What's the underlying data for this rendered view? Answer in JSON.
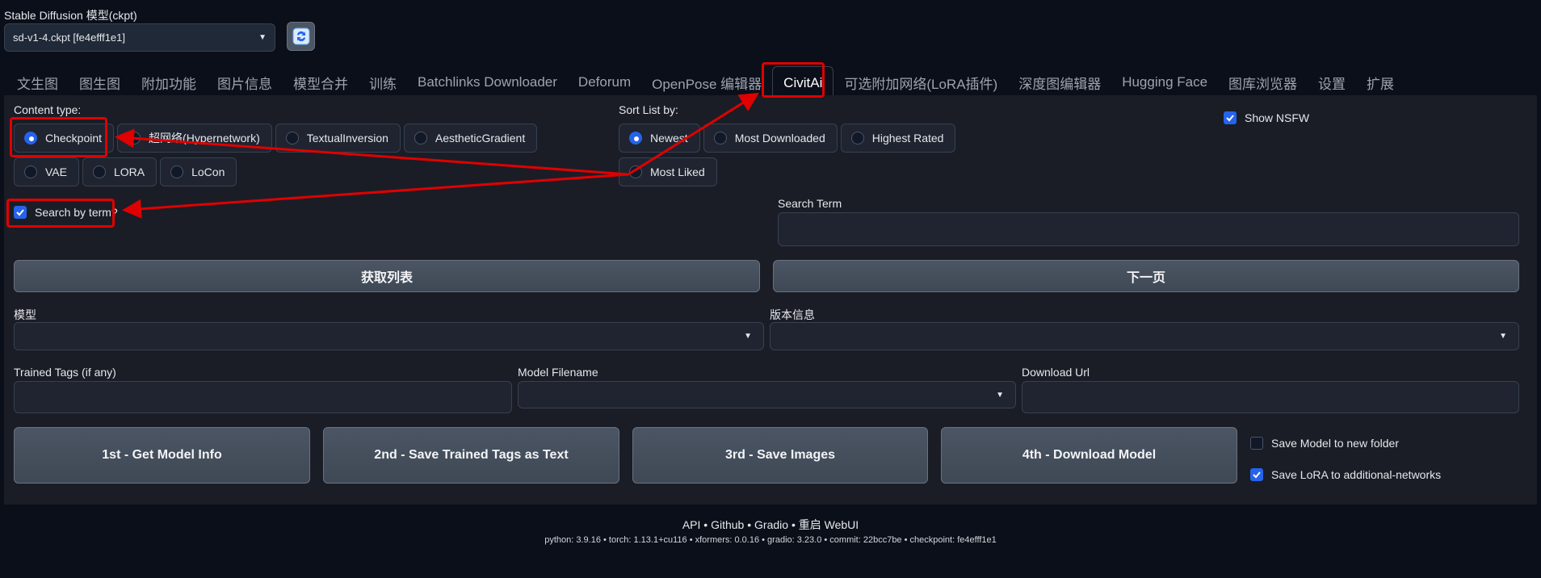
{
  "model": {
    "title": "Stable Diffusion 模型(ckpt)",
    "selected": "sd-v1-4.ckpt [fe4efff1e1]"
  },
  "tabs": [
    {
      "label": "文生图"
    },
    {
      "label": "图生图"
    },
    {
      "label": "附加功能"
    },
    {
      "label": "图片信息"
    },
    {
      "label": "模型合并"
    },
    {
      "label": "训练"
    },
    {
      "label": "Batchlinks Downloader"
    },
    {
      "label": "Deforum"
    },
    {
      "label": "OpenPose 编辑器"
    },
    {
      "label": "CivitAi"
    },
    {
      "label": "可选附加网络(LoRA插件)"
    },
    {
      "label": "深度图编辑器"
    },
    {
      "label": "Hugging Face"
    },
    {
      "label": "图库浏览器"
    },
    {
      "label": "设置"
    },
    {
      "label": "扩展"
    }
  ],
  "content_type": {
    "label": "Content type:",
    "options": [
      "Checkpoint",
      "超网络(Hypernetwork)",
      "TextualInversion",
      "AestheticGradient",
      "VAE",
      "LORA",
      "LoCon"
    ],
    "selected": "Checkpoint"
  },
  "sort": {
    "label": "Sort List by:",
    "options": [
      "Newest",
      "Most Downloaded",
      "Highest Rated",
      "Most Liked"
    ],
    "selected": "Newest"
  },
  "show_nsfw": {
    "label": "Show NSFW",
    "checked": true
  },
  "search_by_term": {
    "label": "Search by term?",
    "checked": true
  },
  "search_term": {
    "label": "Search Term",
    "value": ""
  },
  "buttons": {
    "get_list": "获取列表",
    "next_page": "下一页",
    "get_info": "1st - Get Model Info",
    "save_tags": "2nd - Save Trained Tags as Text",
    "save_images": "3rd - Save Images",
    "download": "4th - Download Model"
  },
  "model_dropdown": {
    "label": "模型",
    "value": ""
  },
  "version_dropdown": {
    "label": "版本信息",
    "value": ""
  },
  "trained_tags": {
    "label": "Trained Tags (if any)",
    "value": ""
  },
  "model_filename": {
    "label": "Model Filename",
    "value": ""
  },
  "download_url": {
    "label": "Download Url",
    "value": ""
  },
  "save_new_folder": {
    "label": "Save Model to new folder",
    "checked": false
  },
  "save_lora": {
    "label": "Save LoRA to additional-networks",
    "checked": true
  },
  "footer": {
    "links": [
      "API",
      "Github",
      "Gradio",
      "重启 WebUI"
    ],
    "info": "python: 3.9.16  •  torch: 1.13.1+cu116  •  xformers: 0.0.16  •  gradio: 3.23.0  •  commit: 22bcc7be  •  checkpoint: fe4efff1e1"
  },
  "colors": {
    "accent": "#2563eb",
    "annotation": "#e00000",
    "background": "#0b0f19"
  }
}
